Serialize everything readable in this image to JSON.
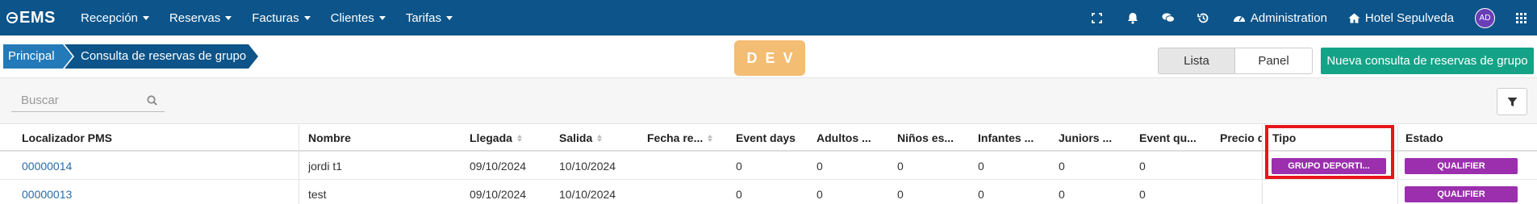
{
  "app": {
    "logo": "EMS"
  },
  "nav": {
    "menus": [
      "Recepción",
      "Reservas",
      "Facturas",
      "Clientes",
      "Tarifas"
    ],
    "administration": "Administration",
    "hotel": "Hotel Sepulveda",
    "avatar": "AD"
  },
  "breadcrumb": {
    "root": "Principal",
    "current": "Consulta de reservas de grupo"
  },
  "env_badge": "DEV",
  "view_toggle": {
    "lista": "Lista",
    "panel": "Panel"
  },
  "new_button": "Nueva consulta de reservas de grupo",
  "search": {
    "placeholder": "Buscar"
  },
  "table": {
    "headers": [
      "Localizador PMS",
      "Nombre",
      "Llegada",
      "Salida",
      "Fecha re...",
      "Event days",
      "Adultos ...",
      "Niños es...",
      "Infantes ...",
      "Juniors ...",
      "Event qu...",
      "Precio d",
      "Tipo",
      "Estado"
    ],
    "rows": [
      {
        "localizador": "00000014",
        "nombre": "jordi t1",
        "llegada": "09/10/2024",
        "salida": "10/10/2024",
        "event_days": "0",
        "adultos": "0",
        "ninos": "0",
        "infantes": "0",
        "juniors": "0",
        "event_qu": "0",
        "tipo": "GRUPO DEPORTI...",
        "estado": "QUALIFIER"
      },
      {
        "localizador": "00000013",
        "nombre": "test",
        "llegada": "09/10/2024",
        "salida": "10/10/2024",
        "event_days": "0",
        "adultos": "0",
        "ninos": "0",
        "infantes": "0",
        "juniors": "0",
        "event_qu": "0",
        "tipo": "",
        "estado": "QUALIFIER"
      }
    ]
  },
  "colors": {
    "nav_bg": "#0c5489",
    "breadcrumb_root": "#247ab8",
    "env_badge": "#f3bd73",
    "primary_action": "#14a387",
    "status_badge": "#9b2fae",
    "highlight": "#e8141b"
  }
}
